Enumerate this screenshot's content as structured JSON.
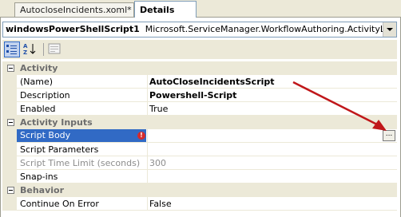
{
  "tabs": [
    {
      "label": "AutocloseIncidents.xoml*"
    },
    {
      "label": "Details"
    }
  ],
  "object_selector": {
    "name": "windowsPowerShellScript1",
    "type": "Microsoft.ServiceManager.WorkflowAuthoring.ActivityLibrary.Win"
  },
  "toolbar": {
    "categorized_icon": "categorized-view-icon",
    "alphabetical_icon": "alphabetical-sort-icon",
    "property_pages_icon": "property-pages-icon"
  },
  "grid": {
    "categories": [
      {
        "label": "Activity",
        "rows": [
          {
            "name": "(Name)",
            "value": "AutoCloseIncidentsScript"
          },
          {
            "name": "Description",
            "value": "Powershell-Script"
          },
          {
            "name": "Enabled",
            "value": "True"
          }
        ]
      },
      {
        "label": "Activity Inputs",
        "rows": [
          {
            "name": "Script Body",
            "value": "",
            "button": "..."
          },
          {
            "name": "Script Parameters",
            "value": ""
          },
          {
            "name": "Script Time Limit (seconds)",
            "value": "300"
          },
          {
            "name": "Snap-ins",
            "value": ""
          }
        ]
      },
      {
        "label": "Behavior",
        "rows": [
          {
            "name": "Continue On Error",
            "value": "False"
          }
        ]
      }
    ]
  },
  "colors": {
    "selection": "#316ac5",
    "annotation_arrow": "#c0171a",
    "error_icon": "#d62b2b"
  }
}
